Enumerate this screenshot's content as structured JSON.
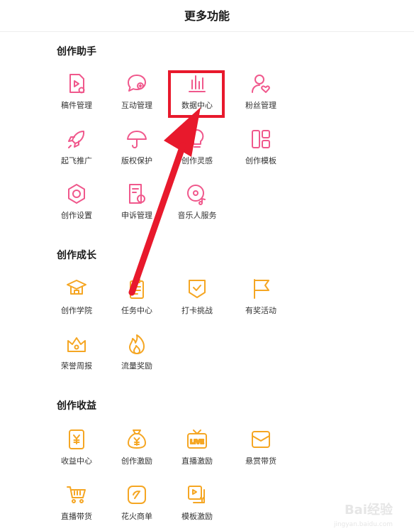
{
  "header": {
    "title": "更多功能"
  },
  "sections": [
    {
      "title": "创作助手",
      "items": [
        {
          "label": "稿件管理",
          "icon": "document-play-icon"
        },
        {
          "label": "互动管理",
          "icon": "chat-plus-icon"
        },
        {
          "label": "数据中心",
          "icon": "bar-chart-icon"
        },
        {
          "label": "粉丝管理",
          "icon": "user-heart-icon"
        },
        {
          "label": "起飞推广",
          "icon": "rocket-icon"
        },
        {
          "label": "版权保护",
          "icon": "umbrella-icon"
        },
        {
          "label": "创作灵感",
          "icon": "lightbulb-icon"
        },
        {
          "label": "创作模板",
          "icon": "layout-grid-icon"
        },
        {
          "label": "创作设置",
          "icon": "hexagon-gear-icon"
        },
        {
          "label": "申诉管理",
          "icon": "document-info-icon"
        },
        {
          "label": "音乐人服务",
          "icon": "music-disc-icon"
        }
      ]
    },
    {
      "title": "创作成长",
      "items": [
        {
          "label": "创作学院",
          "icon": "academy-icon"
        },
        {
          "label": "任务中心",
          "icon": "clipboard-icon"
        },
        {
          "label": "打卡挑战",
          "icon": "check-shield-icon"
        },
        {
          "label": "有奖活动",
          "icon": "flag-icon"
        },
        {
          "label": "荣誉周报",
          "icon": "crown-box-icon"
        },
        {
          "label": "流量奖励",
          "icon": "fire-icon"
        }
      ]
    },
    {
      "title": "创作收益",
      "items": [
        {
          "label": "收益中心",
          "icon": "yuan-card-icon"
        },
        {
          "label": "创作激励",
          "icon": "money-bag-icon"
        },
        {
          "label": "直播激励",
          "icon": "live-tv-icon"
        },
        {
          "label": "悬赏带货",
          "icon": "envelope-icon"
        },
        {
          "label": "直播带货",
          "icon": "cart-icon"
        },
        {
          "label": "花火商单",
          "icon": "spark-badge-icon"
        },
        {
          "label": "模板激励",
          "icon": "template-yuan-icon"
        }
      ]
    }
  ],
  "colors": {
    "primary_pink": "#f0588c",
    "primary_orange": "#f5a623",
    "highlight_red": "#e8192c"
  },
  "watermark": {
    "logo": "Bai经验",
    "url": "jingyan.baidu.com"
  }
}
